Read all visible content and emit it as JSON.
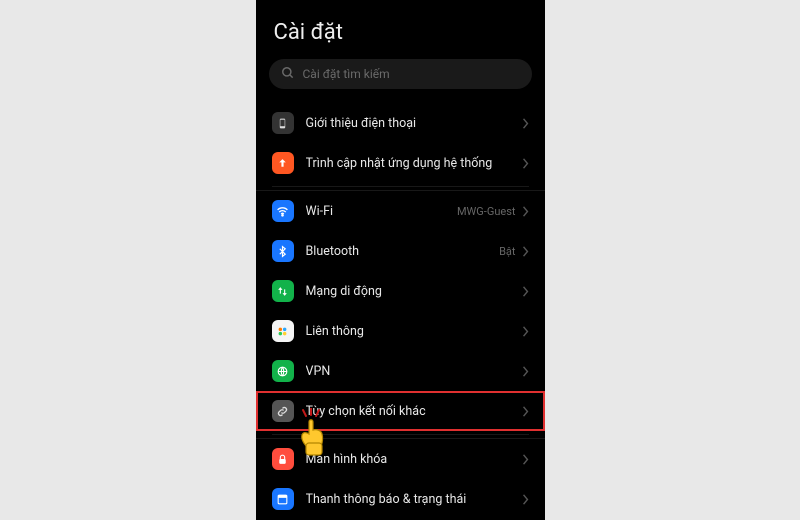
{
  "header": {
    "title": "Cài đặt"
  },
  "search": {
    "placeholder": "Cài đặt tìm kiếm"
  },
  "groups": [
    {
      "rows": [
        {
          "id": "about-phone",
          "icon": "about",
          "label": "Giới thiệu điện thoại",
          "value": ""
        },
        {
          "id": "system-update",
          "icon": "update",
          "label": "Trình cập nhật ứng dụng hệ thống",
          "value": ""
        }
      ]
    },
    {
      "rows": [
        {
          "id": "wifi",
          "icon": "wifi",
          "label": "Wi-Fi",
          "value": "MWG-Guest"
        },
        {
          "id": "bluetooth",
          "icon": "bluetooth",
          "label": "Bluetooth",
          "value": "Bật"
        },
        {
          "id": "mobile-data",
          "icon": "mobile",
          "label": "Mạng di động",
          "value": ""
        },
        {
          "id": "interop",
          "icon": "interop",
          "label": "Liên thông",
          "value": ""
        },
        {
          "id": "vpn",
          "icon": "vpn",
          "label": "VPN",
          "value": ""
        },
        {
          "id": "other-conn",
          "icon": "other",
          "label": "Tùy chọn kết nối khác",
          "value": "",
          "highlighted": true
        }
      ]
    },
    {
      "rows": [
        {
          "id": "lockscreen",
          "icon": "lock",
          "label": "Màn hình khóa",
          "value": ""
        },
        {
          "id": "statusbar",
          "icon": "status",
          "label": "Thanh thông báo & trạng thái",
          "value": ""
        }
      ]
    }
  ],
  "icons": {
    "about": "phone",
    "update": "arrow-up",
    "wifi": "wifi",
    "bluetooth": "bluetooth",
    "mobile": "arrows",
    "interop": "dots",
    "vpn": "globe",
    "other": "link",
    "lock": "lock",
    "status": "window"
  }
}
